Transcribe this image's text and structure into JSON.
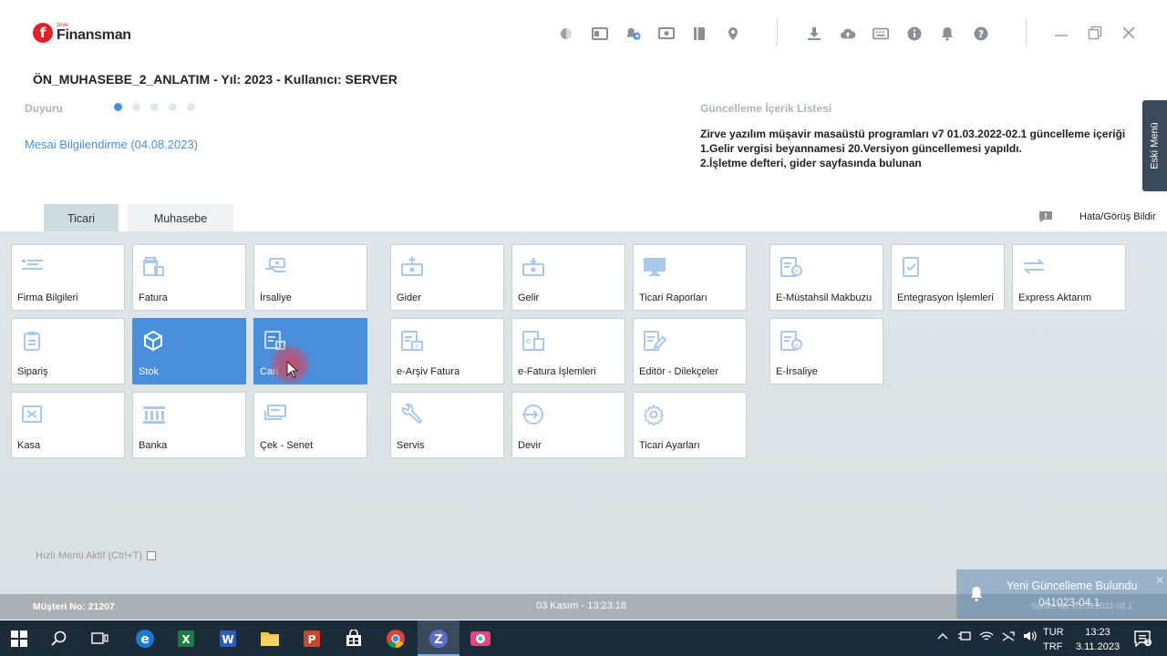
{
  "app": {
    "logo_small": "zirve",
    "logo_name": "Finansman"
  },
  "header": {
    "title": "ÖN_MUHASEBE_2_ANLATIM - Yıl: 2023 - Kullanıcı: SERVER"
  },
  "announcement": {
    "label": "Duyuru",
    "active_dot": 0,
    "dot_count": 5,
    "link": "Mesai Bilgilendirme (04.08.2023)"
  },
  "updates": {
    "title": "Güncelleme İçerik Listesi",
    "lines": [
      "Zirve yazılım müşavir masaüstü programları v7 01.03.2022-02.1 güncelleme içeriği",
      "1.Gelir vergisi beyannamesi 20.Versiyon güncellemesi yapıldı.",
      "2.İşletme defteri, gider sayfasında bulunan"
    ]
  },
  "side_button": {
    "label": "Eski Menü"
  },
  "tabs": [
    {
      "label": "Ticari",
      "active": true
    },
    {
      "label": "Muhasebe",
      "active": false
    }
  ],
  "feedback": {
    "label": "Hata/Görüş Bildir"
  },
  "tiles": [
    {
      "label": "Firma Bilgileri",
      "icon": "list-icon"
    },
    {
      "label": "Fatura",
      "icon": "invoice-icon"
    },
    {
      "label": "İrsaliye",
      "icon": "dispatch-icon"
    },
    {
      "label": "Gider",
      "icon": "expense-icon"
    },
    {
      "label": "Gelir",
      "icon": "income-icon"
    },
    {
      "label": "Ticari Raporları",
      "icon": "monitor-icon"
    },
    {
      "label": "E-Müstahsil Makbuzu",
      "icon": "e-document-icon"
    },
    {
      "label": "Entegrasyon İşlemleri",
      "icon": "integration-icon"
    },
    {
      "label": "Express Aktarım",
      "icon": "transfer-icon"
    },
    {
      "label": "Sipariş",
      "icon": "clipboard-icon"
    },
    {
      "label": "Stok",
      "icon": "box-icon",
      "selected": true
    },
    {
      "label": "Cari",
      "icon": "account-icon",
      "selected": true
    },
    {
      "label": "e-Arşiv Fatura",
      "icon": "e-archive-icon"
    },
    {
      "label": "e-Fatura İşlemleri",
      "icon": "e-invoice-icon"
    },
    {
      "label": "Editör - Dilekçeler",
      "icon": "editor-icon"
    },
    {
      "label": "E-İrsaliye",
      "icon": "e-dispatch-icon"
    },
    {
      "label": "Kasa",
      "icon": "cash-register-icon"
    },
    {
      "label": "Banka",
      "icon": "bank-icon"
    },
    {
      "label": "Çek - Senet",
      "icon": "cheque-icon"
    },
    {
      "label": "Servis",
      "icon": "wrench-icon"
    },
    {
      "label": "Devir",
      "icon": "carry-over-icon"
    },
    {
      "label": "Ticari Ayarları",
      "icon": "gear-icon"
    }
  ],
  "quick_menu": {
    "label": "Hızlı Menü Aktif (Ctrl+T)",
    "checked": false
  },
  "status": {
    "customer": "Müşteri No: 21207",
    "datetime": "03 Kasım - 13:23:18"
  },
  "toast": {
    "title": "Yeni Güncelleme Bulundu",
    "subtitle": "041023-04.1",
    "version": "Sürüm No: 01.03.2022-02.1"
  },
  "taskbar": {
    "lang_top": "TUR",
    "lang_bottom": "TRF",
    "time": "13:23",
    "date": "3.11.2023",
    "notifications": "1"
  },
  "colors": {
    "accent": "#4a8fdc",
    "brand_red": "#e02127",
    "tile_selected": "#4a8fdc",
    "content_bg": "#dfe6e9",
    "statusbar": "#a9b1b5",
    "taskbar": "#1c2b39"
  }
}
